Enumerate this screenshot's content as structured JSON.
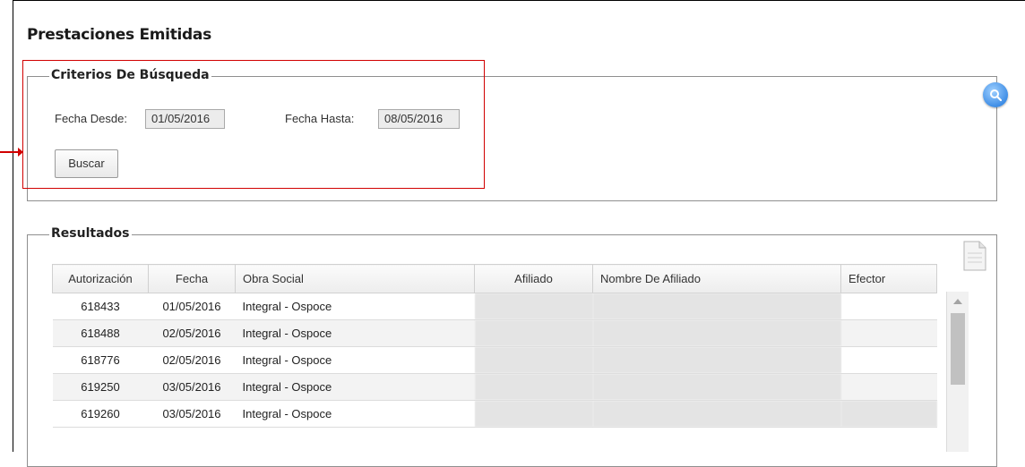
{
  "page": {
    "title": "Prestaciones Emitidas"
  },
  "criteria": {
    "legend": "Criterios De Búsqueda",
    "fecha_desde_label": "Fecha Desde:",
    "fecha_desde_value": "01/05/2016",
    "fecha_hasta_label": "Fecha Hasta:",
    "fecha_hasta_value": "08/05/2016",
    "buscar_label": "Buscar"
  },
  "results": {
    "legend": "Resultados",
    "columns": [
      "Autorización",
      "Fecha",
      "Obra Social",
      "Afiliado",
      "Nombre De Afiliado",
      "Efector"
    ],
    "rows": [
      {
        "autorizacion": "618433",
        "fecha": "01/05/2016",
        "obra_social": "Integral - Ospoce",
        "afiliado": "",
        "nombre": "",
        "efector": ""
      },
      {
        "autorizacion": "618488",
        "fecha": "02/05/2016",
        "obra_social": "Integral - Ospoce",
        "afiliado": "",
        "nombre": "",
        "efector": ""
      },
      {
        "autorizacion": "618776",
        "fecha": "02/05/2016",
        "obra_social": "Integral - Ospoce",
        "afiliado": "",
        "nombre": "",
        "efector": ""
      },
      {
        "autorizacion": "619250",
        "fecha": "03/05/2016",
        "obra_social": "Integral - Ospoce",
        "afiliado": "",
        "nombre": "",
        "efector": ""
      },
      {
        "autorizacion": "619260",
        "fecha": "03/05/2016",
        "obra_social": "Integral - Ospoce",
        "afiliado": "",
        "nombre": "",
        "efector": ""
      }
    ]
  },
  "icons": {
    "search": "search-icon",
    "export": "document-icon"
  },
  "colors": {
    "highlight": "#d10000",
    "search_button": "#3f8ee6"
  }
}
